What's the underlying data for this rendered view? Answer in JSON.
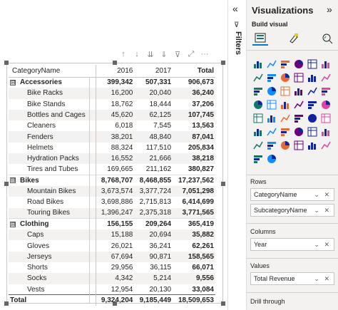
{
  "matrix": {
    "headers": [
      "CategoryName",
      "2016",
      "2017",
      "Total"
    ],
    "rows": [
      {
        "type": "cat",
        "label": "Accessories",
        "v": [
          "399,342",
          "507,331",
          "906,673"
        ],
        "expander": "⊟"
      },
      {
        "type": "sub",
        "label": "Bike Racks",
        "v": [
          "16,200",
          "20,040",
          "36,240"
        ]
      },
      {
        "type": "sub",
        "label": "Bike Stands",
        "v": [
          "18,762",
          "18,444",
          "37,206"
        ]
      },
      {
        "type": "sub",
        "label": "Bottles and Cages",
        "v": [
          "45,620",
          "62,125",
          "107,745"
        ]
      },
      {
        "type": "sub",
        "label": "Cleaners",
        "v": [
          "6,018",
          "7,545",
          "13,563"
        ]
      },
      {
        "type": "sub",
        "label": "Fenders",
        "v": [
          "38,201",
          "48,840",
          "87,041"
        ]
      },
      {
        "type": "sub",
        "label": "Helmets",
        "v": [
          "88,324",
          "117,510",
          "205,834"
        ]
      },
      {
        "type": "sub",
        "label": "Hydration Packs",
        "v": [
          "16,552",
          "21,666",
          "38,218"
        ]
      },
      {
        "type": "sub",
        "label": "Tires and Tubes",
        "v": [
          "169,665",
          "211,162",
          "380,827"
        ]
      },
      {
        "type": "cat",
        "label": "Bikes",
        "v": [
          "8,768,707",
          "8,468,855",
          "17,237,562"
        ],
        "expander": "⊟"
      },
      {
        "type": "sub",
        "label": "Mountain Bikes",
        "v": [
          "3,673,574",
          "3,377,724",
          "7,051,298"
        ]
      },
      {
        "type": "sub",
        "label": "Road Bikes",
        "v": [
          "3,698,886",
          "2,715,813",
          "6,414,699"
        ]
      },
      {
        "type": "sub",
        "label": "Touring Bikes",
        "v": [
          "1,396,247",
          "2,375,318",
          "3,771,565"
        ]
      },
      {
        "type": "cat",
        "label": "Clothing",
        "v": [
          "156,155",
          "209,264",
          "365,419"
        ],
        "expander": "⊟"
      },
      {
        "type": "sub",
        "label": "Caps",
        "v": [
          "15,188",
          "20,694",
          "35,882"
        ]
      },
      {
        "type": "sub",
        "label": "Gloves",
        "v": [
          "26,021",
          "36,241",
          "62,261"
        ]
      },
      {
        "type": "sub",
        "label": "Jerseys",
        "v": [
          "67,694",
          "90,871",
          "158,565"
        ]
      },
      {
        "type": "sub",
        "label": "Shorts",
        "v": [
          "29,956",
          "36,115",
          "66,071"
        ]
      },
      {
        "type": "sub",
        "label": "Socks",
        "v": [
          "4,342",
          "5,214",
          "9,556"
        ]
      },
      {
        "type": "sub",
        "label": "Vests",
        "v": [
          "12,954",
          "20,130",
          "33,084"
        ]
      },
      {
        "type": "grand",
        "label": "Total",
        "v": [
          "9,324,204",
          "9,185,449",
          "18,509,653"
        ]
      }
    ]
  },
  "visual_toolbar": {
    "icons": [
      "drill-up-icon",
      "drill-down-icon",
      "next-level-icon",
      "expand-all-icon",
      "filter-icon",
      "focus-mode-icon",
      "more-options-icon"
    ],
    "glyphs": [
      "↑",
      "↓",
      "⇊",
      "⇓",
      "⊽",
      "⤢",
      "···"
    ]
  },
  "filters_pane": {
    "collapse_glyph": "«",
    "title": "Filters"
  },
  "viz_pane": {
    "title": "Visualizations",
    "collapse_glyph": "»",
    "build_visual": "Build visual",
    "rows_label": "Rows",
    "rows_fields": [
      "CategoryName",
      "SubcategoryName"
    ],
    "columns_label": "Columns",
    "columns_fields": [
      "Year"
    ],
    "values_label": "Values",
    "values_fields": [
      "Total Revenue"
    ],
    "drill_label": "Drill through"
  },
  "colors": {
    "accent": "#0078d4",
    "text": "#252423",
    "pane": "#f3f2f1"
  }
}
